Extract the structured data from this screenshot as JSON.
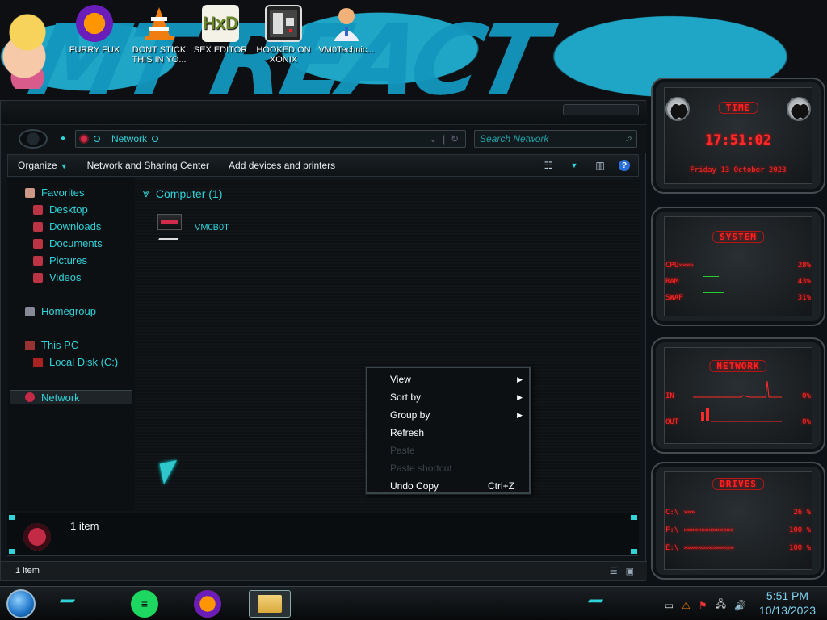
{
  "desktop": {
    "icons": [
      {
        "label": "FURRY FUX",
        "icon": "firefox-icon"
      },
      {
        "label": "DONT STICK THIS IN YO...",
        "icon": "vlc-icon"
      },
      {
        "label": "SEX EDITOR",
        "icon": "hxd-editor-icon"
      },
      {
        "label": "HOOKED ON XONIX",
        "icon": "xonix-game-icon"
      },
      {
        "label": "VM0Technic...",
        "icon": "doctor-user-icon"
      }
    ]
  },
  "explorer": {
    "address": "Network",
    "search_placeholder": "Search Network",
    "toolbar": {
      "organize": "Organize",
      "network_center": "Network and Sharing Center",
      "add_devices": "Add devices and printers"
    },
    "nav": {
      "favorites": "Favorites",
      "desktop": "Desktop",
      "downloads": "Downloads",
      "documents": "Documents",
      "pictures": "Pictures",
      "videos": "Videos",
      "homegroup": "Homegroup",
      "this_pc": "This PC",
      "local_disk": "Local Disk (C:)",
      "network": "Network"
    },
    "group_header": "Computer (1)",
    "items": [
      {
        "name": "VM0B0T"
      }
    ],
    "details_text": "1 item",
    "status_text": "1 item"
  },
  "context_menu": {
    "view": "View",
    "sort_by": "Sort by",
    "group_by": "Group by",
    "refresh": "Refresh",
    "paste": "Paste",
    "paste_shortcut": "Paste shortcut",
    "undo_copy": "Undo Copy",
    "undo_copy_shortcut": "Ctrl+Z"
  },
  "gadgets": {
    "time": {
      "title": "TIME",
      "clock": "17:51:02",
      "date": "Friday 13 October 2023"
    },
    "system": {
      "title": "SYSTEM",
      "cpu_label": "CPU",
      "cpu_value": "28%",
      "ram_label": "RAM",
      "ram_value": "43%",
      "swap_label": "SWAP",
      "swap_value": "31%"
    },
    "network": {
      "title": "NETWORK",
      "in_label": "IN",
      "in_value": "0%",
      "out_label": "OUT",
      "out_value": "0%"
    },
    "drives": {
      "title": "DRIVES",
      "d1_label": "C:\\",
      "d1_value": "26 %",
      "d2_label": "F:\\",
      "d2_value": "100 %",
      "d3_label": "E:\\",
      "d3_value": "100 %"
    }
  },
  "taskbar": {
    "time": "5:51 PM",
    "date": "10/13/2023"
  },
  "colors": {
    "accent_cyan": "#2fd3d8",
    "gadget_red": "#ff2a2a"
  }
}
